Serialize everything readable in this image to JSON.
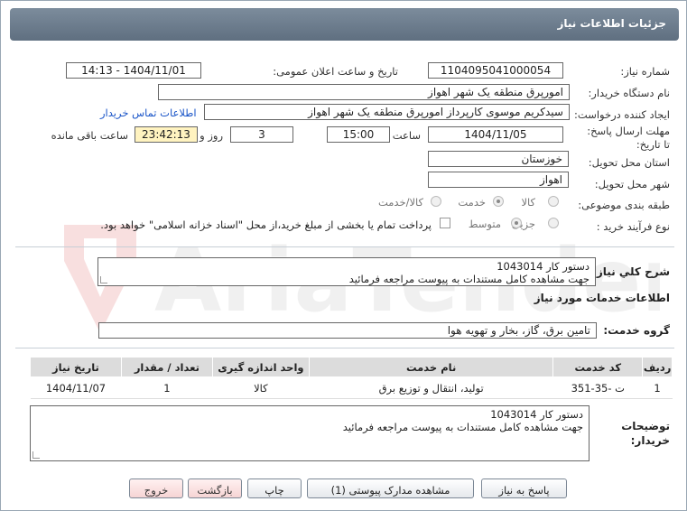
{
  "window": {
    "title": "جزئیات اطلاعات نیاز"
  },
  "labels": {
    "need_number": "شماره نیاز:",
    "announce_datetime": "تاریخ و ساعت اعلان عمومی:",
    "buyer_org": "نام دستگاه خریدار:",
    "requester": "ایجاد کننده درخواست:",
    "deadline": "مهلت ارسال پاسخ: تا تاریخ:",
    "time": "ساعت",
    "and_day": "روز و",
    "time_remaining": "ساعت باقی مانده",
    "province": "استان محل تحویل:",
    "city": "شهر محل تحویل:",
    "category": "طبقه بندی موضوعی:",
    "process_type": "نوع فرآیند خرید :",
    "need_summary": "شرح کلي نياز:",
    "services_info": "اطلاعات خدمات مورد نیاز",
    "service_group": "گروه خدمت:",
    "buyer_notes_line1": "توضیحات",
    "buyer_notes_line2": "خریدار:"
  },
  "fields": {
    "need_number": "1104095041000054",
    "announce_datetime": "1404/11/01 - 14:13",
    "buyer_org": "امورپرق منطقه یک شهر اهواز",
    "requester": "سیدکریم موسوی کارپرداز امورپرق منطقه یک شهر اهواز",
    "contact_link": "اطلاعات تماس خریدار",
    "deadline_date": "1404/11/05",
    "deadline_time": "15:00",
    "days": "3",
    "remaining": "23:42:13",
    "province": "خوزستان",
    "city": "اهواز",
    "service_group": "تامین برق، گاز، بخار و تهویه هوا"
  },
  "category_options": [
    {
      "label": "کالا",
      "selected": false
    },
    {
      "label": "خدمت",
      "selected": true
    },
    {
      "label": "کالا/خدمت",
      "selected": false
    }
  ],
  "process_options": [
    {
      "label": "جزیی",
      "selected": false
    },
    {
      "label": "متوسط",
      "selected": true
    }
  ],
  "payment_note": "پرداخت تمام یا بخشی از مبلغ خرید،از محل \"اسناد خزانه اسلامی\" خواهد بود.",
  "need_summary_lines": [
    "دستور کار 1043014",
    "جهت مشاهده کامل مستندات به پیوست مراجعه فرمائید"
  ],
  "buyer_notes_lines": [
    "دستور کار 1043014",
    "جهت مشاهده کامل مستندات به پیوست مراجعه فرمائید"
  ],
  "table": {
    "headers": [
      "ردیف",
      "کد خدمت",
      "نام خدمت",
      "واحد اندازه گیری",
      "تعداد / مقدار",
      "تاریخ نیاز"
    ],
    "rows": [
      [
        "1",
        "ت -35-351",
        "تولید، انتقال و توزیع برق",
        "کالا",
        "1",
        "1404/11/07"
      ]
    ]
  },
  "buttons": {
    "respond": "پاسخ به نیاز",
    "attachments": "مشاهده مدارک پیوستی (1)",
    "print": "چاپ",
    "back": "بازگشت",
    "exit": "خروج"
  },
  "watermark_text": "AriaTender.net",
  "colors": {
    "titlebar": "#6b7b8c",
    "link": "#1a55c8",
    "remaining_bg": "#fff3c0",
    "exit_btn": "#f6d4d4"
  }
}
